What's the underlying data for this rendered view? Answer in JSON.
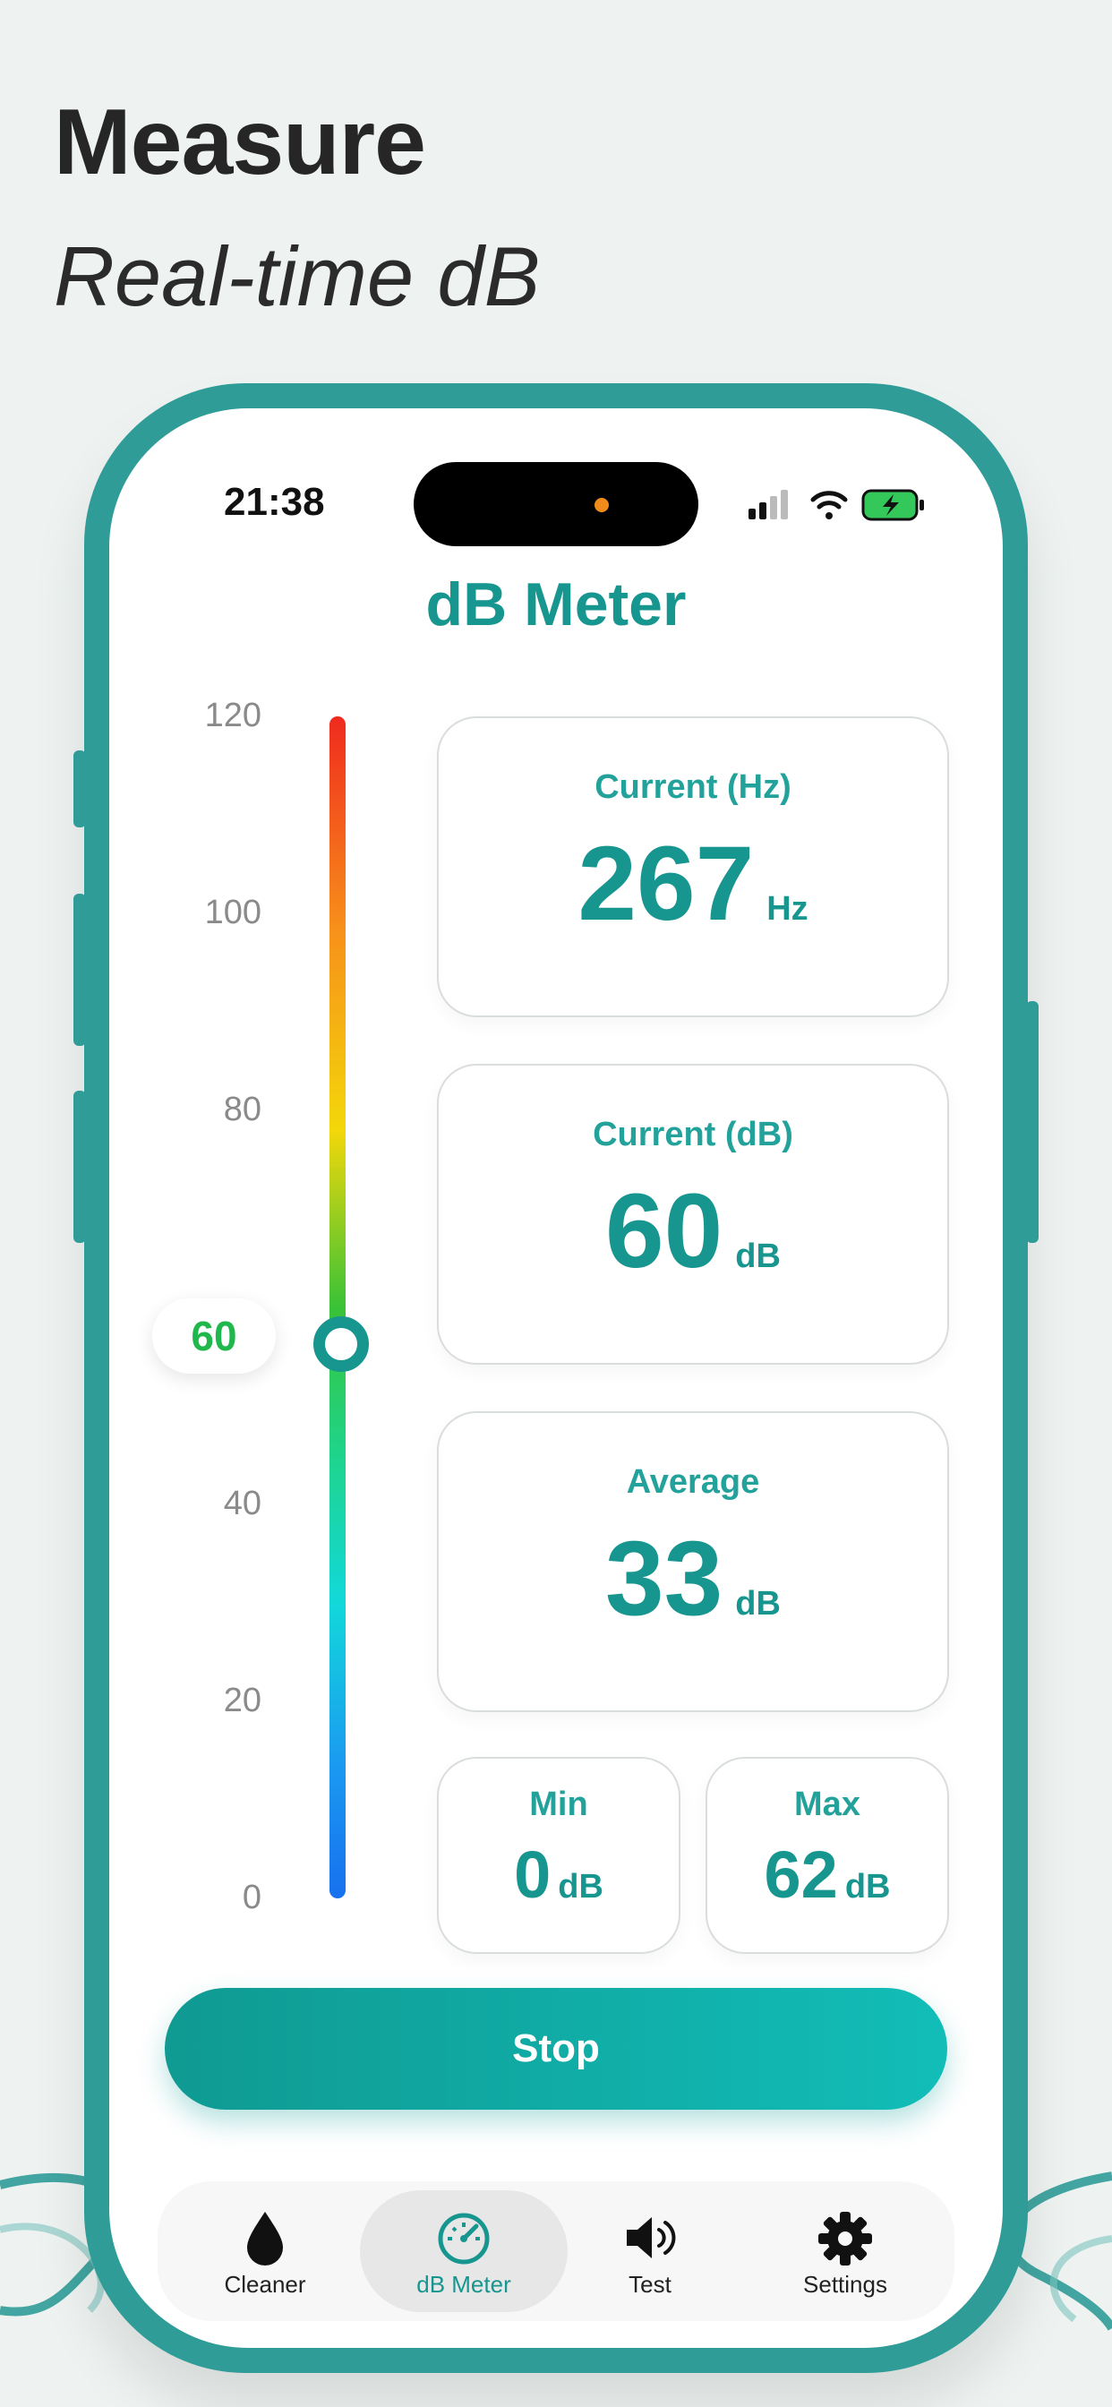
{
  "promo": {
    "headline": "Measure",
    "subline": "Real-time dB"
  },
  "status_bar": {
    "time": "21:38"
  },
  "app": {
    "title": "dB Meter"
  },
  "meter": {
    "scale_labels": [
      "120",
      "100",
      "80",
      "40",
      "20",
      "0"
    ],
    "current_value": "60",
    "level": 60,
    "range": [
      0,
      120
    ]
  },
  "cards": {
    "hz": {
      "label": "Current (Hz)",
      "value": "267",
      "unit": "Hz"
    },
    "db": {
      "label": "Current (dB)",
      "value": "60",
      "unit": "dB"
    },
    "avg": {
      "label": "Average",
      "value": "33",
      "unit": "dB"
    },
    "min": {
      "label": "Min",
      "value": "0",
      "unit": "dB"
    },
    "max": {
      "label": "Max",
      "value": "62",
      "unit": "dB"
    }
  },
  "stop_button": {
    "label": "Stop"
  },
  "tabbar": {
    "items": [
      {
        "label": "Cleaner",
        "icon": "drop-icon"
      },
      {
        "label": "dB Meter",
        "icon": "gauge-icon",
        "active": true
      },
      {
        "label": "Test",
        "icon": "speaker-icon"
      },
      {
        "label": "Settings",
        "icon": "gear-icon"
      }
    ]
  },
  "colors": {
    "accent": "#17958f",
    "frame": "#2f9c98",
    "background": "#eef3f1",
    "level_green": "#20b84c"
  }
}
